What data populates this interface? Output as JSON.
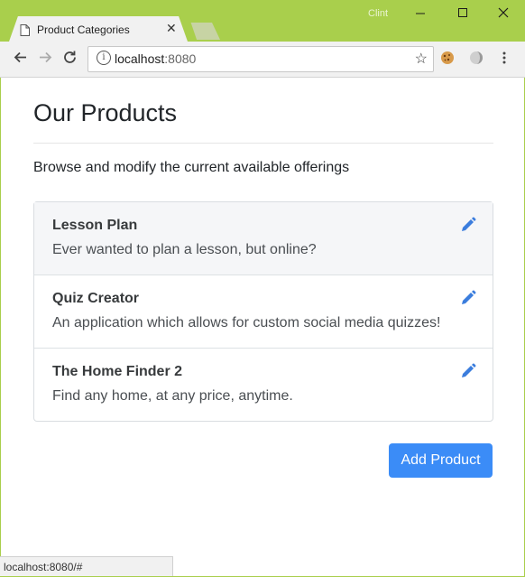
{
  "browser": {
    "tab_title": "Product Categories",
    "tab_close": "✕",
    "profile_name": "Clint",
    "url_host": "localhost",
    "url_port": ":8080",
    "status_url": "localhost:8080/#"
  },
  "page": {
    "title": "Our Products",
    "lead": "Browse and modify the current available offerings",
    "products": [
      {
        "name": "Lesson Plan",
        "description": "Ever wanted to plan a lesson, but online?"
      },
      {
        "name": "Quiz Creator",
        "description": "An application which allows for custom social media quizzes!"
      },
      {
        "name": "The Home Finder 2",
        "description": "Find any home, at any price, anytime."
      }
    ],
    "add_button": "Add Product"
  },
  "colors": {
    "frame": "#a9cf4c",
    "accent": "#3b8cf7",
    "edit_icon": "#3b7ddd"
  },
  "icons": [
    "page-icon",
    "back-icon",
    "forward-icon",
    "reload-icon",
    "info-icon",
    "star-icon",
    "cookie-icon",
    "extension-icon",
    "menu-icon",
    "pencil-icon"
  ]
}
